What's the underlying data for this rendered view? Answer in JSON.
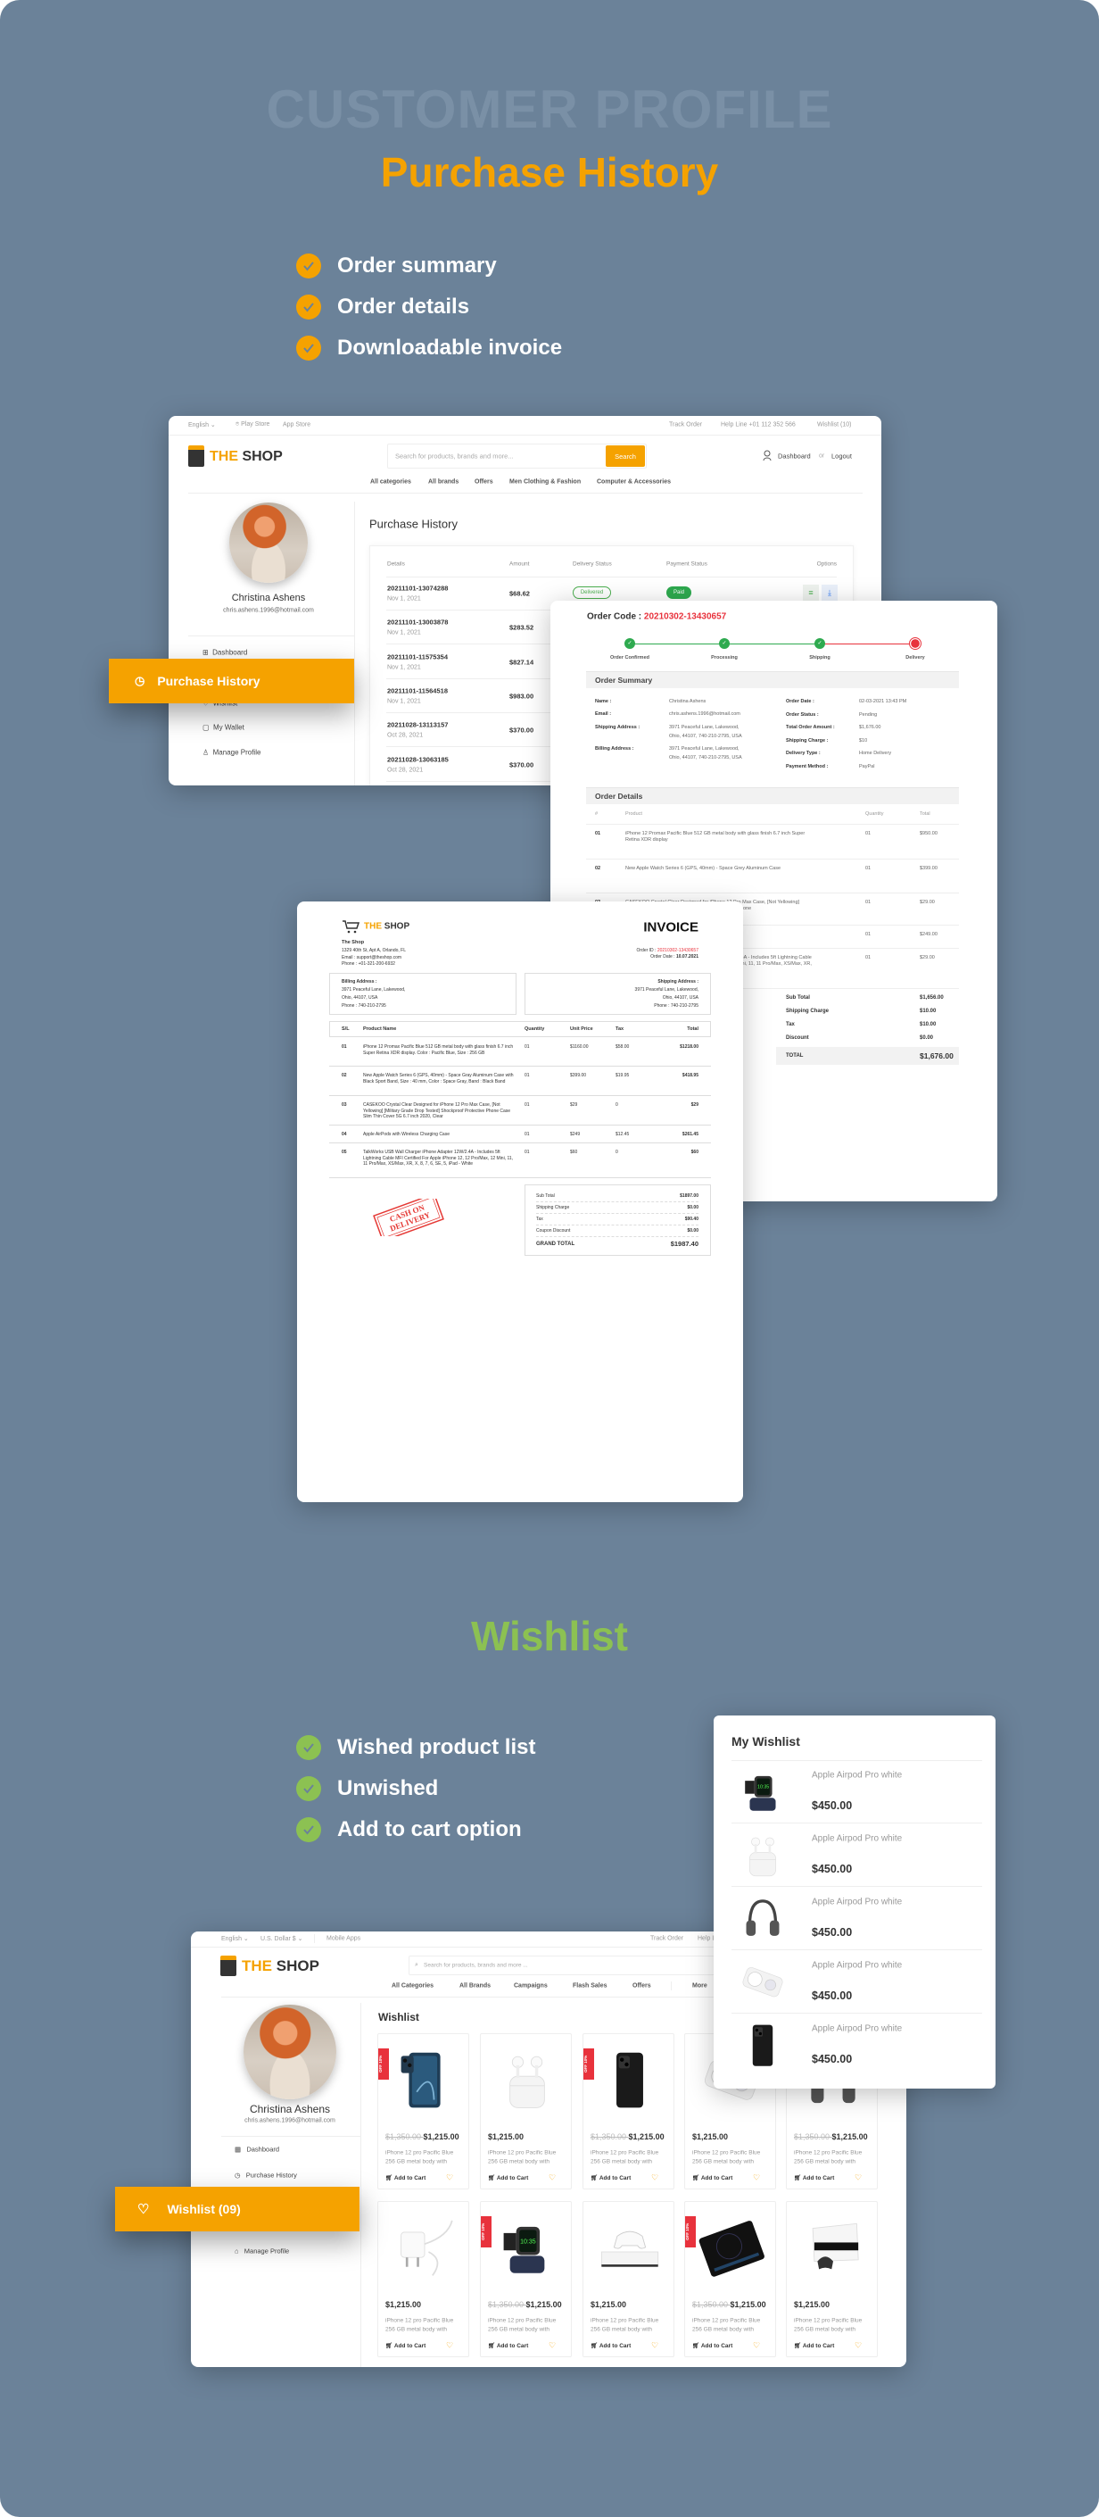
{
  "hero": {
    "watermark": "CUSTOMER PROFILE",
    "title": "Purchase History",
    "title_color": "#f5a200",
    "features": [
      "Order summary",
      "Order details",
      "Downloadable invoice"
    ],
    "check_color": "#f5a200"
  },
  "shop1": {
    "topbar": {
      "language": "English",
      "play_store": "Play Store",
      "app_store": "App Store",
      "track_order": "Track Order",
      "help_line": "Help Line +01 112 352 566",
      "wishlist": "Wishlist (10)"
    },
    "logo_a": "THE",
    "logo_b": "SHOP",
    "search_placeholder": "Search for products, brands and more...",
    "search_button": "Search",
    "dashboard": "Dashboard",
    "or": "or",
    "logout": "Logout",
    "nav": [
      "All categories",
      "All brands",
      "Offers",
      "Men Clothing & Fashion",
      "Computer & Accessories"
    ],
    "profile": {
      "name": "Christina Ashens",
      "email": "chris.ashens.1996@hotmail.com"
    },
    "menu": {
      "dashboard": "Dashboard",
      "wishlist": "Wishlist",
      "wallet": "My Wallet",
      "manage": "Manage Profile"
    },
    "active_tab": "Purchase History",
    "page_title": "Purchase History",
    "table": {
      "headers": [
        "Details",
        "Amount",
        "Delivery Status",
        "Payment Status",
        "Options"
      ],
      "rows": [
        {
          "code": "20211101-13074288",
          "date": "Nov 1, 2021",
          "amount": "$68.62",
          "delivery": "Delivered",
          "payment": "Paid"
        },
        {
          "code": "20211101-13003878",
          "date": "Nov 1, 2021",
          "amount": "$283.52"
        },
        {
          "code": "20211101-11575354",
          "date": "Nov 1, 2021",
          "amount": "$827.14"
        },
        {
          "code": "20211101-11564518",
          "date": "Nov 1, 2021",
          "amount": "$983.00"
        },
        {
          "code": "20211028-13113157",
          "date": "Oct 28, 2021",
          "amount": "$370.00"
        },
        {
          "code": "20211028-13063185",
          "date": "Oct 28, 2021",
          "amount": "$370.00"
        }
      ]
    }
  },
  "order": {
    "code_label": "Order Code :",
    "code": "20210302-13430657",
    "steps": [
      {
        "label": "Order Confirmed",
        "done": true
      },
      {
        "label": "Processing",
        "done": true
      },
      {
        "label": "Shipping",
        "done": true
      },
      {
        "label": "Delivery",
        "done": false
      }
    ],
    "summary_title": "Order Summary",
    "summary_left": [
      {
        "k": "Name :",
        "v": "Christina Ashens"
      },
      {
        "k": "Email :",
        "v": "chris.ashens.1996@hotmail.com"
      },
      {
        "k": "Shipping Address :",
        "v": "3971  Peaceful Lane, Lakewood,",
        "v2": "Ohio, 44107, 740-210-2795, USA"
      },
      {
        "k": "Billing Address :",
        "v": "3971  Peaceful Lane, Lakewood,",
        "v2": "Ohio, 44107, 740-210-2795, USA"
      }
    ],
    "summary_right": [
      {
        "k": "Order Date :",
        "v": "02-03-2021 13:43 PM"
      },
      {
        "k": "Order Status :",
        "v": "Pending"
      },
      {
        "k": "Total Order Amount :",
        "v": "$1,676.00"
      },
      {
        "k": "Shipping Charge :",
        "v": "$10"
      },
      {
        "k": "Delivery Type :",
        "v": "Home Delivery"
      },
      {
        "k": "Payment Method :",
        "v": "PayPal"
      }
    ],
    "details_title": "Order Details",
    "details_headers": [
      "#",
      "Product",
      "Quantity",
      "Total"
    ],
    "details_rows": [
      {
        "n": "01",
        "product": "iPhone 12 Promax Pacific Blue 512 GB metal body with glass finish 6.7 inch Super Retina XDR display",
        "qty": "01",
        "total": "$950.00"
      },
      {
        "n": "02",
        "product": "New Apple Watch Series 6 (GPS, 40mm) - Space Grey Aluminum Case",
        "qty": "01",
        "total": "$399.00"
      },
      {
        "n": "03",
        "product": "CASEKOO Crystal Clear Designed for iPhone 12 Pro Max Case, [Not Yellowing] [Military Grade Drop Tested] Shockproof Protective Phone",
        "qty": "01",
        "total": "$29.00"
      },
      {
        "n": "04",
        "product": "Apple AirPods with Wireless Charging Case",
        "qty": "01",
        "total": "$249.00"
      },
      {
        "n": "05",
        "product": "TalkWorks USB Wall Charger iPhone Adapter 12W/2.4A - Includes 5ft Lightning Cable MFI Certified For Apple iPhone 12, 12 Pro/Max, 12 Mini, 11, 11 Pro/Max, XS/Max, XR, X, 8, 7, 6, SE, 5, iPad - White",
        "qty": "01",
        "total": "$29.00"
      }
    ],
    "totals": [
      {
        "k": "Sub Total",
        "v": "$1,656.00"
      },
      {
        "k": "Shipping Charge",
        "v": "$10.00"
      },
      {
        "k": "Tax",
        "v": "$10.00"
      },
      {
        "k": "Discount",
        "v": "$0.00"
      }
    ],
    "grand": {
      "k": "TOTAL",
      "v": "$1,676.00"
    }
  },
  "invoice": {
    "logo_a": "THE",
    "logo_b": "SHOP",
    "title": "INVOICE",
    "shop_name": "The Shop",
    "shop_lines": [
      "1329 40th St, Apt A, Orlando, FL",
      "Email : support@theshop.com",
      "Phone : +01-321-200-6932"
    ],
    "order_id_label": "Order ID :",
    "order_id": "20210302-13430657",
    "order_date_label": "Order Date :",
    "order_date": "10.07.2021",
    "billing": {
      "title": "Billing Address :",
      "lines": [
        "3971  Peaceful Lane, Lakewood,",
        "Ohio, 44107, USA",
        "Phone : 740-210-2795"
      ]
    },
    "shipping": {
      "title": "Shipping Address :",
      "lines": [
        "3971  Peaceful Lane, Lakewood,",
        "Ohio, 44107, USA",
        "Phone : 740-210-2795"
      ]
    },
    "headers": [
      "S/L",
      "Product Name",
      "Quantity",
      "Unit Price",
      "Tax",
      "Total"
    ],
    "rows": [
      {
        "n": "01",
        "product": "iPhone 12 Promax Pacific Blue 512 GB metal body with glass finish 6.7 inch Super Retina XDR display. Color : Pacific Blue, Size : 256 GB",
        "qty": "01",
        "unit": "$1160.00",
        "tax": "$58.00",
        "total": "$1218.00"
      },
      {
        "n": "02",
        "product": "New Apple Watch Series 6 (GPS, 40mm) - Space Gray Aluminum Case with Black Sport Band, Size : 40 mm, Color : Space Gray, Band : Black Band",
        "qty": "01",
        "unit": "$399.00",
        "tax": "$19.95",
        "total": "$418.95"
      },
      {
        "n": "03",
        "product": "CASEKOO Crystal Clear Designed for iPhone 12 Pro Max Case, [Not Yellowing] [Military Grade Drop Tested] Shockproof Protective Phone Case Slim Thin Cover 5G 6.7 inch 2020, Clear",
        "qty": "01",
        "unit": "$29",
        "tax": "0",
        "total": "$29"
      },
      {
        "n": "04",
        "product": "Apple AirPods with Wireless Charging Case",
        "qty": "01",
        "unit": "$249",
        "tax": "$12.45",
        "total": "$261.45"
      },
      {
        "n": "05",
        "product": "TalkWorks USB Wall Charger iPhone Adapter 12W/2.4A - Includes 5ft Lightning Cable MFI Certified For Apple iPhone 12, 12 Pro/Max, 12 Mini, 11, 11 Pro/Max, XS/Max, XR, X, 8, 7, 6, SE, 5, iPad - White",
        "qty": "01",
        "unit": "$60",
        "tax": "0",
        "total": "$60"
      }
    ],
    "totals": [
      {
        "k": "Sub Total",
        "v": "$1897.00"
      },
      {
        "k": "Shipping Charge",
        "v": "$0.00"
      },
      {
        "k": "Tax",
        "v": "$90.40"
      },
      {
        "k": "Coupon Discount",
        "v": "$0.00"
      }
    ],
    "grand": {
      "k": "GRAND TOTAL",
      "v": "$1987.40"
    },
    "stamp": [
      "CASH ON",
      "DELIVERY"
    ],
    "stamp_color": "#e53935"
  },
  "wish_hero": {
    "title": "Wishlist",
    "title_color": "#8cc152",
    "features": [
      "Wished product list",
      "Unwished",
      "Add to cart option"
    ],
    "check_color": "#8cc152"
  },
  "shop2": {
    "topbar": {
      "language": "English",
      "currency": "U.S. Dollar $",
      "mobile_apps": "Mobile Apps",
      "track_order": "Track Order",
      "help_line": "Help Line"
    },
    "logo_a": "THE",
    "logo_b": "SHOP",
    "search_placeholder": "Search for products, brands and more ...",
    "nav": [
      "All Categories",
      "All Brands",
      "Campaigns",
      "Flash Sales",
      "Offers",
      "More"
    ],
    "profile": {
      "name": "Christina Ashens",
      "email": "chris.ashens.1996@hotmail.com"
    },
    "menu": {
      "dashboard": "Dashboard",
      "purchase": "Purchase History",
      "manage": "Manage Profile"
    },
    "active_tab": "Wishlist (09)",
    "page_title": "Wishlist",
    "add_to_cart": "Add to Cart",
    "cards": [
      {
        "img": "phone-blue",
        "badge": "OFF 10%",
        "old": "$1,350.00",
        "price": "$1,215.00",
        "desc": [
          "iPhone 12 pro Pacific Blue",
          "256 GB metal body with"
        ]
      },
      {
        "img": "airpods",
        "price": "$1,215.00",
        "desc": [
          "iPhone 12 pro Pacific Blue",
          "256 GB metal body with"
        ]
      },
      {
        "img": "phone-black",
        "badge": "OFF 10%",
        "old": "$1,350.00",
        "price": "$1,215.00",
        "desc": [
          "iPhone 12 pro Pacific Blue",
          "256 GB metal body with"
        ]
      },
      {
        "img": "magsafe",
        "price": "$1,215.00",
        "desc": [
          "iPhone 12 pro Pacific Blue",
          "256 GB metal body with"
        ]
      },
      {
        "img": "headphones",
        "old": "$1,350.00",
        "price": "$1,215.00",
        "desc": [
          "iPhone 12 pro Pacific Blue",
          "256 GB metal body with"
        ]
      },
      {
        "img": "charger",
        "price": "$1,215.00",
        "desc": [
          "iPhone 12 pro Pacific Blue",
          "256 GB metal body with"
        ]
      },
      {
        "img": "watch-stand",
        "badge": "OFF 10%",
        "old": "$1,350.00",
        "price": "$1,215.00",
        "desc": [
          "iPhone 12 pro Pacific Blue",
          "256 GB metal body with"
        ]
      },
      {
        "img": "xbox",
        "price": "$1,215.00",
        "desc": [
          "iPhone 12 pro Pacific Blue",
          "256 GB metal body with"
        ]
      },
      {
        "img": "induction-cooker",
        "badge": "OFF 10%",
        "old": "$1,350.00",
        "price": "$1,215.00",
        "desc": [
          "iPhone 12 pro Pacific Blue",
          "256 GB metal body with"
        ]
      },
      {
        "img": "ps5",
        "price": "$1,215.00",
        "desc": [
          "iPhone 12 pro Pacific Blue",
          "256 GB metal body with"
        ]
      }
    ]
  },
  "my_wishlist": {
    "title": "My Wishlist",
    "items": [
      {
        "img": "watch-stand",
        "name": "Apple Airpod Pro white",
        "price": "$450.00"
      },
      {
        "img": "airpods",
        "name": "Apple Airpod Pro white",
        "price": "$450.00"
      },
      {
        "img": "headphones",
        "name": "Apple Airpod Pro white",
        "price": "$450.00"
      },
      {
        "img": "magsafe",
        "name": "Apple Airpod Pro white",
        "price": "$450.00"
      },
      {
        "img": "phone-black",
        "name": "Apple Airpod Pro white",
        "price": "$450.00"
      }
    ]
  },
  "colors": {
    "accent": "#f5a200",
    "background": "#6b8299",
    "red": "#e8323c",
    "green": "#2eaa4f"
  }
}
